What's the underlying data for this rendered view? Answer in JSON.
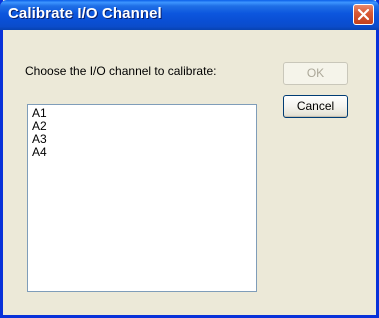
{
  "window": {
    "title": "Calibrate I/O Channel",
    "close_icon": "close-x-icon",
    "accent_color": "#0a4fd4",
    "close_color": "#d95a36"
  },
  "dialog": {
    "prompt": "Choose the I/O channel to calibrate:",
    "channels": [
      "A1",
      "A2",
      "A3",
      "A4"
    ],
    "ok_label": "OK",
    "ok_enabled": false,
    "cancel_label": "Cancel"
  }
}
